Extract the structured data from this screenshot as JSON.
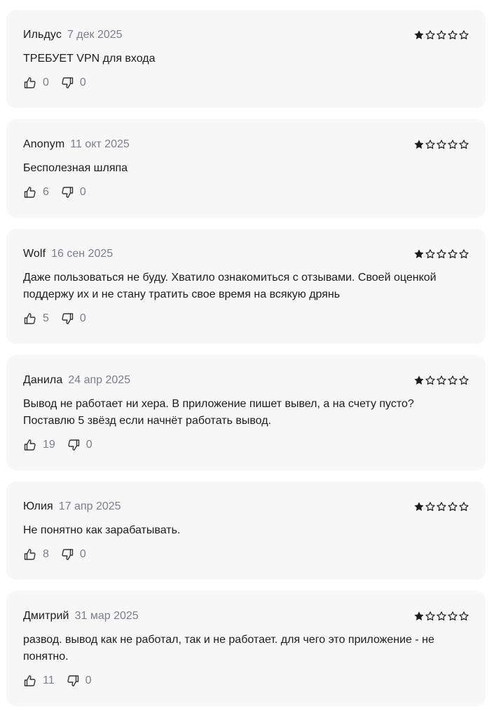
{
  "reviews": [
    {
      "author": "Ильдус",
      "date": "7 дек 2025",
      "rating": 1,
      "text": "ТРЕБУЕТ VPN для входа",
      "likes": "0",
      "dislikes": "0"
    },
    {
      "author": "Anonym",
      "date": "11 окт 2025",
      "rating": 1,
      "text": "Бесполезная шляпа",
      "likes": "6",
      "dislikes": "0"
    },
    {
      "author": "Wolf",
      "date": "16 сен 2025",
      "rating": 1,
      "text": "Даже пользоваться не буду. Хватило ознакомиться с отзывами. Своей оценкой поддержу их и не стану тратить свое время на всякую дрянь",
      "likes": "5",
      "dislikes": "0"
    },
    {
      "author": "Данила",
      "date": "24 апр 2025",
      "rating": 1,
      "text": "Вывод не работает ни хера. В приложение пишет вывел, а на счету пусто? Поставлю 5 звёзд если начнёт работать вывод.",
      "likes": "19",
      "dislikes": "0"
    },
    {
      "author": "Юлия",
      "date": "17 апр 2025",
      "rating": 1,
      "text": "Не понятно как зарабатывать.",
      "likes": "8",
      "dislikes": "0"
    },
    {
      "author": "Дмитрий",
      "date": "31 мар 2025",
      "rating": 1,
      "text": "развод. вывод как не работал, так и не работает. для чего это приложение - не понятно.",
      "likes": "11",
      "dislikes": "0"
    }
  ],
  "colors": {
    "card_bg": "#f7f7f7",
    "text": "#1c1c1c",
    "muted": "#7c7f87"
  },
  "icons": {
    "like": "thumbs-up-icon",
    "dislike": "thumbs-down-icon",
    "star_filled": "star-filled-icon",
    "star_empty": "star-outline-icon"
  }
}
